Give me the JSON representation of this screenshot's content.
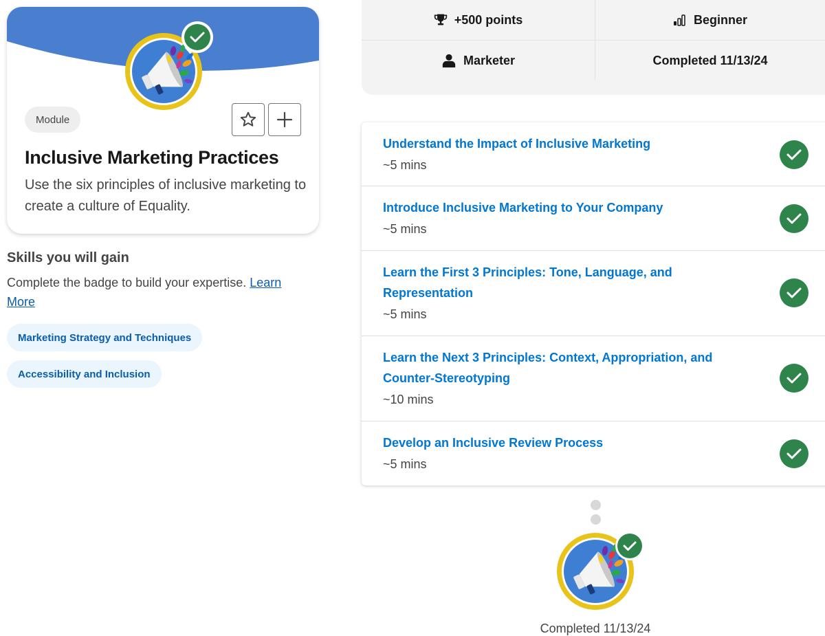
{
  "module_card": {
    "type_label": "Module",
    "title": "Inclusive Marketing Practices",
    "description": "Use the six principles of inclusive marketing to create a culture of Equality.",
    "banner_color": "#4a7fcf",
    "icons": [
      "star-icon",
      "plus-icon",
      "megaphone-badge-icon",
      "checkmark-icon"
    ]
  },
  "skills": {
    "title": "Skills you will gain",
    "description": "Complete the badge to build your expertise.",
    "link_label": "Learn More",
    "chips": [
      "Marketing Strategy and Techniques",
      "Accessibility and Inclusion"
    ]
  },
  "info": {
    "points": "+500 points",
    "level": "Beginner",
    "role": "Marketer",
    "completed": "Completed 11/13/24"
  },
  "units": [
    {
      "title": "Understand the Impact of Inclusive Marketing",
      "time": "~5 mins",
      "status": "completed"
    },
    {
      "title": "Introduce Inclusive Marketing to Your Company",
      "time": "~5 mins",
      "status": "completed"
    },
    {
      "title": "Learn the First 3 Principles: Tone, Language, and Representation",
      "time": "~5 mins",
      "status": "completed"
    },
    {
      "title": "Learn the Next 3 Principles: Context, Appropriation, and Counter-Stereotyping",
      "time": "~10 mins",
      "status": "completed"
    },
    {
      "title": "Develop an Inclusive Review Process",
      "time": "~5 mins",
      "status": "completed"
    }
  ],
  "bottom": {
    "completed": "Completed 11/13/24"
  },
  "colors": {
    "link_blue": "#0176d3",
    "check_green": "#2e844a",
    "badge_gold": "#e8c31a",
    "badge_blue": "#3e7fd3"
  }
}
